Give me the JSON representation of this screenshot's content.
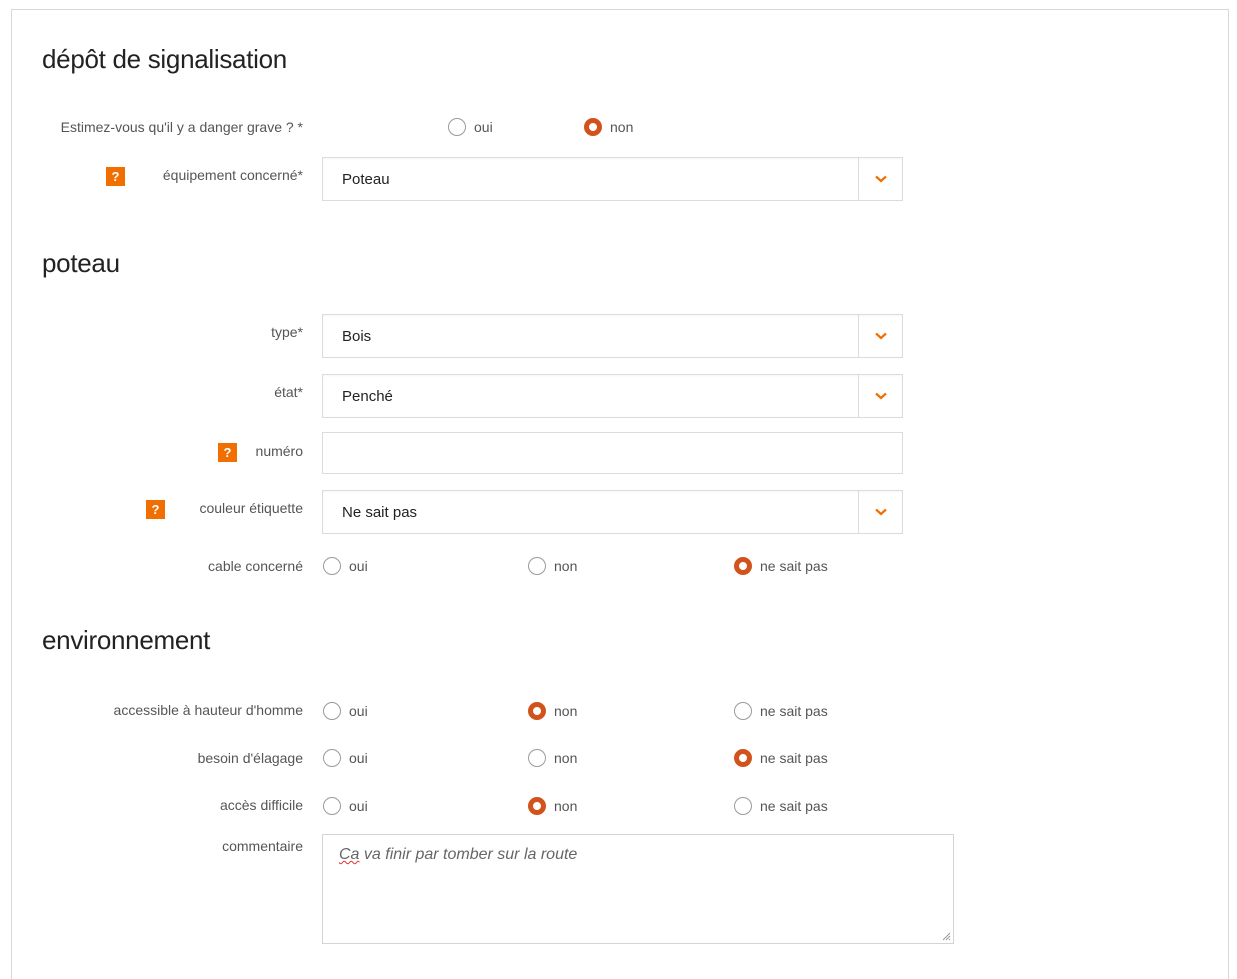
{
  "sections": {
    "depot": "dépôt de signalisation",
    "poteau": "poteau",
    "environnement": "environnement"
  },
  "danger": {
    "label": "Estimez-vous qu'il y a danger grave ? *",
    "options": [
      "oui",
      "non"
    ],
    "selected": "non"
  },
  "equipement": {
    "label": "équipement concerné*",
    "value": "Poteau"
  },
  "type": {
    "label": "type*",
    "value": "Bois"
  },
  "etat": {
    "label": "état*",
    "value": "Penché"
  },
  "numero": {
    "label": "numéro",
    "value": ""
  },
  "couleur": {
    "label": "couleur étiquette",
    "value": "Ne sait pas"
  },
  "cable": {
    "label": "cable concerné",
    "options": [
      "oui",
      "non",
      "ne sait pas"
    ],
    "selected": "ne sait pas"
  },
  "accessible": {
    "label": "accessible à hauteur d'homme",
    "options": [
      "oui",
      "non",
      "ne sait pas"
    ],
    "selected": "non"
  },
  "elagage": {
    "label": "besoin d'élagage",
    "options": [
      "oui",
      "non",
      "ne sait pas"
    ],
    "selected": "ne sait pas"
  },
  "acces": {
    "label": "accès difficile",
    "options": [
      "oui",
      "non",
      "ne sait pas"
    ],
    "selected": "non"
  },
  "commentaire": {
    "label": "commentaire",
    "value_first_word": "Ca",
    "value_rest": " va finir par tomber sur la route"
  },
  "help_icon_glyph": "?",
  "colors": {
    "accent": "#f16e00",
    "radio_checked": "#d2521c"
  }
}
